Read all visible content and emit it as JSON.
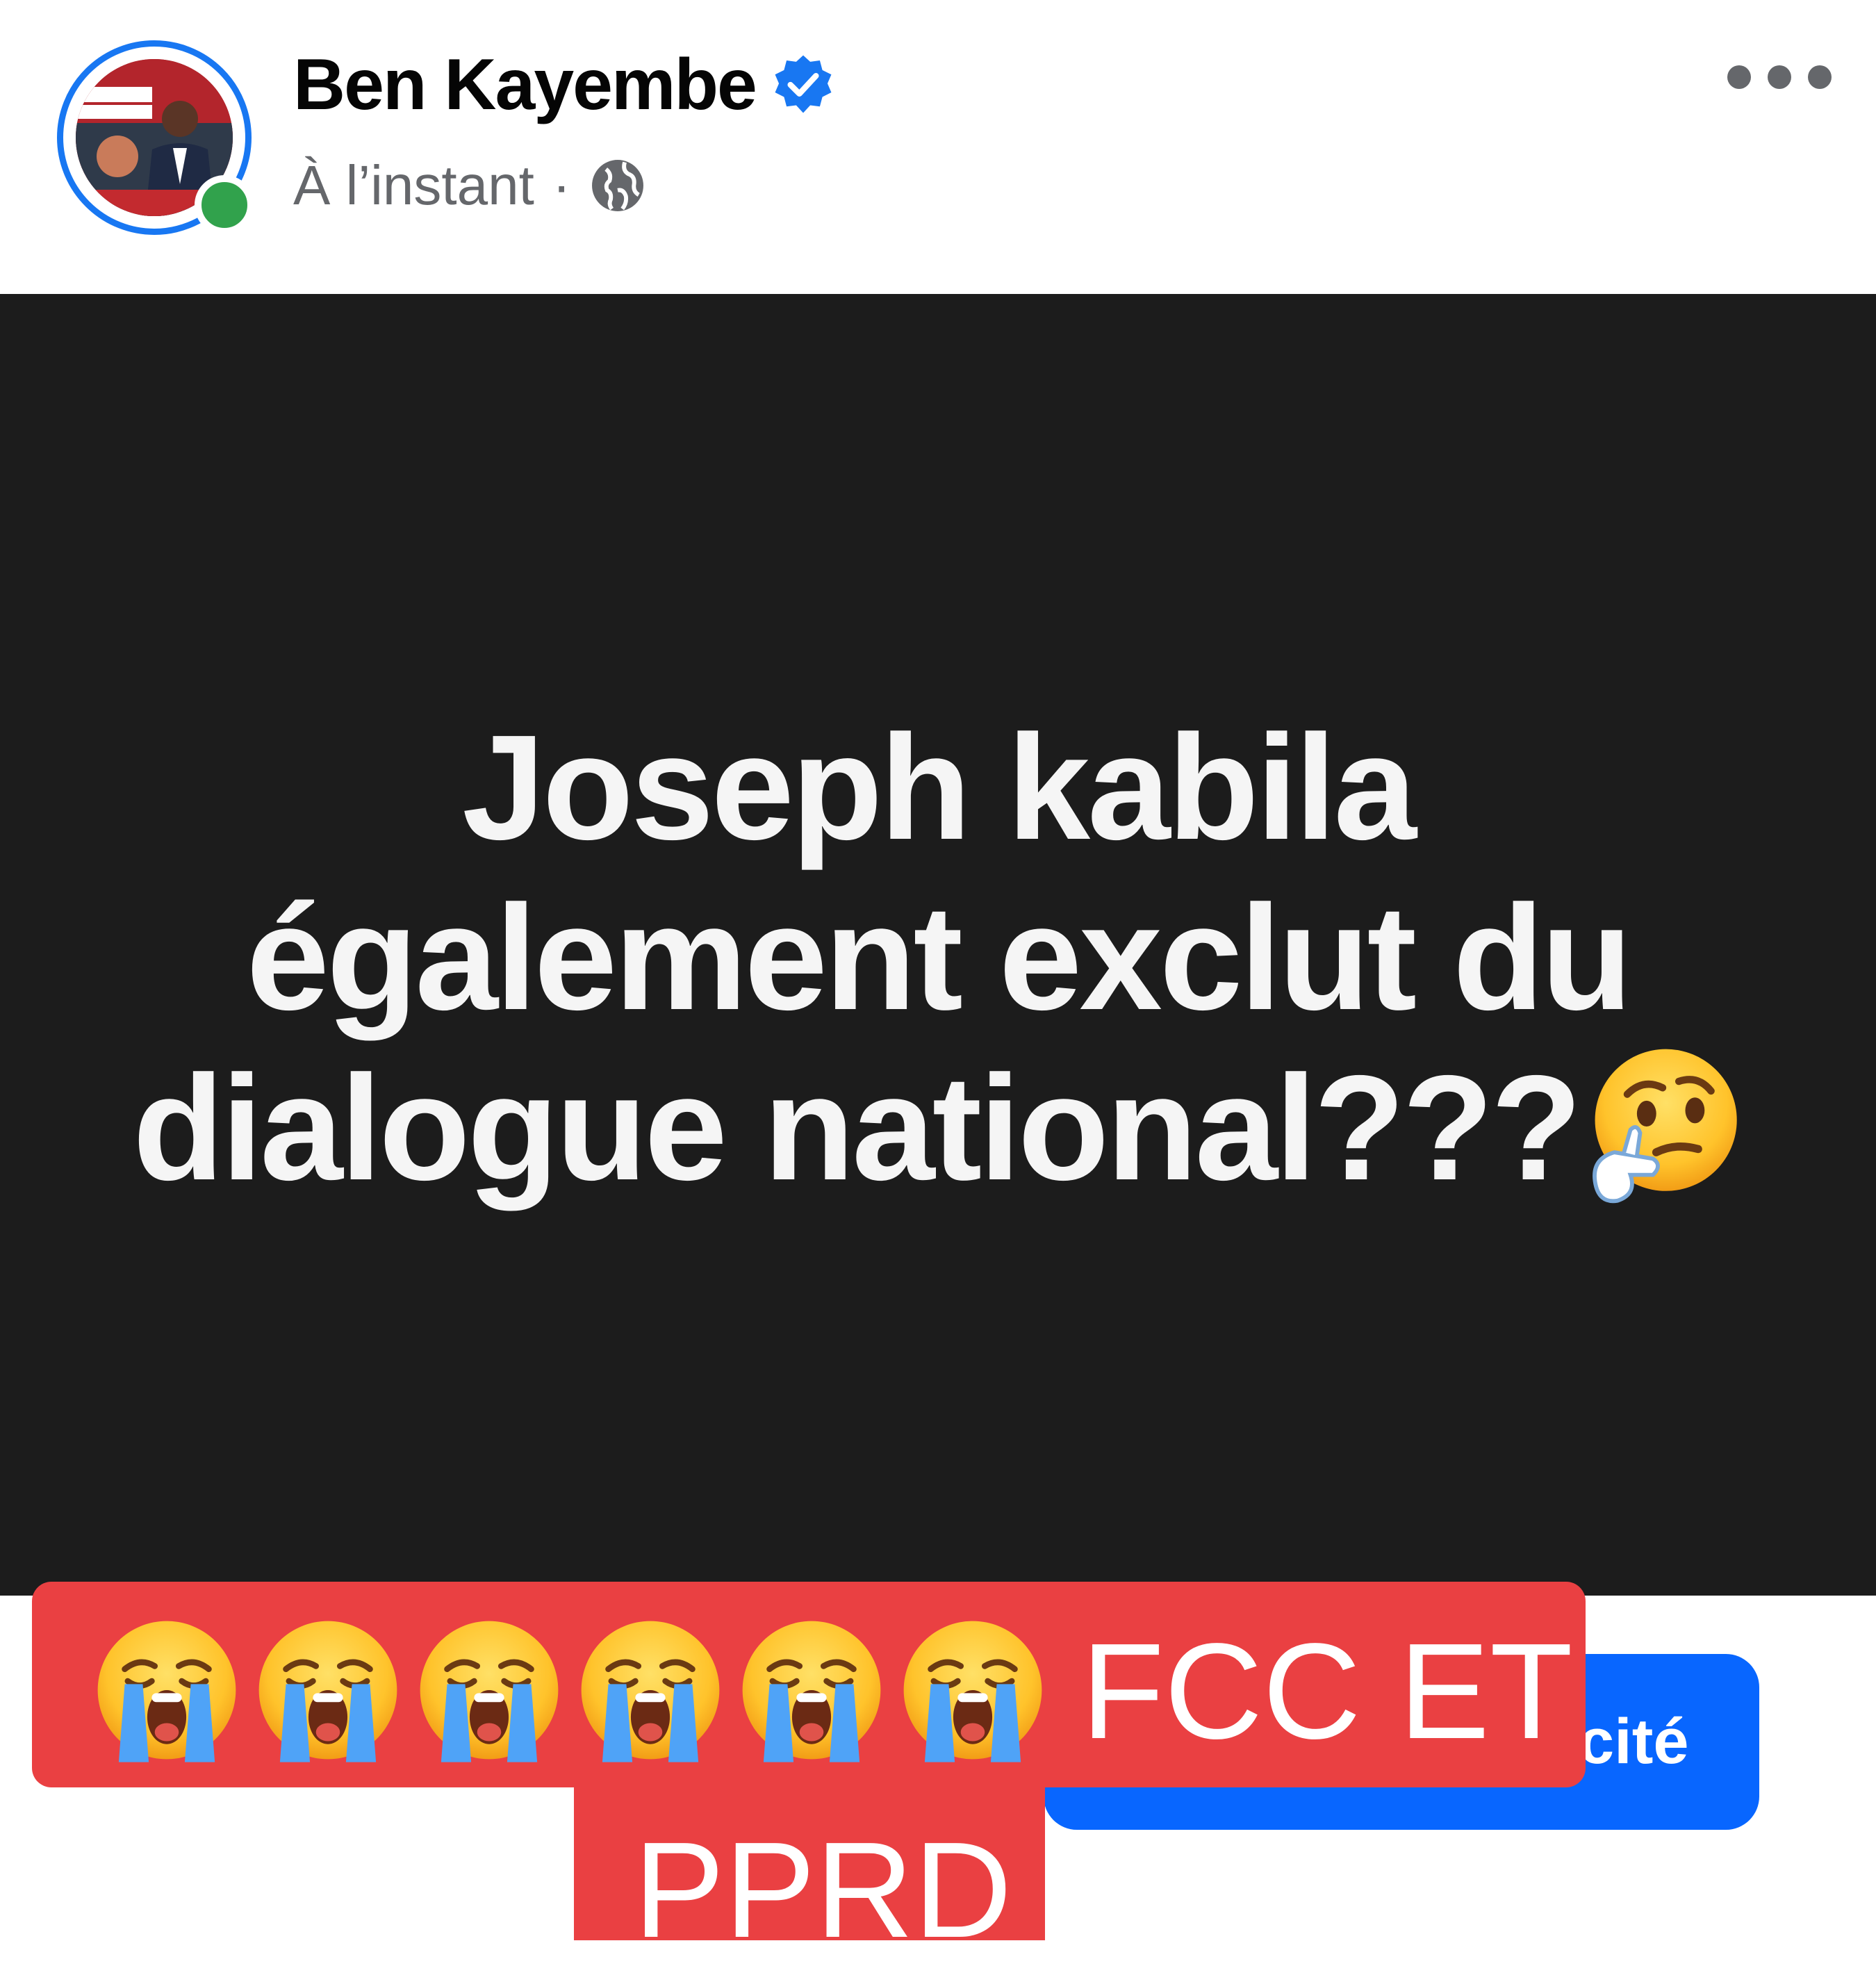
{
  "post": {
    "author": "Ben Kayembe",
    "timestamp": "À l’instant",
    "separator": "·",
    "visibility_icon": "globe-icon",
    "verified_icon": "verified-badge-icon",
    "more_icon": "more-options-icon",
    "status_text_line1": "Joseph kabila",
    "status_text_line2": "également exclut du",
    "status_text_line3": "dialogue national???",
    "status_emoji": "thinking-face",
    "background_color": "#1c1c1c"
  },
  "cta": {
    "label": "cité"
  },
  "caption": {
    "emojis": [
      "loudly-crying-face",
      "loudly-crying-face",
      "loudly-crying-face",
      "loudly-crying-face",
      "loudly-crying-face",
      "loudly-crying-face"
    ],
    "line1": "FCC ET",
    "line2": "PPRD",
    "background_color": "#ea4042"
  },
  "colors": {
    "accent": "#1877f2",
    "online": "#31a24c",
    "cta": "#0866ff"
  }
}
